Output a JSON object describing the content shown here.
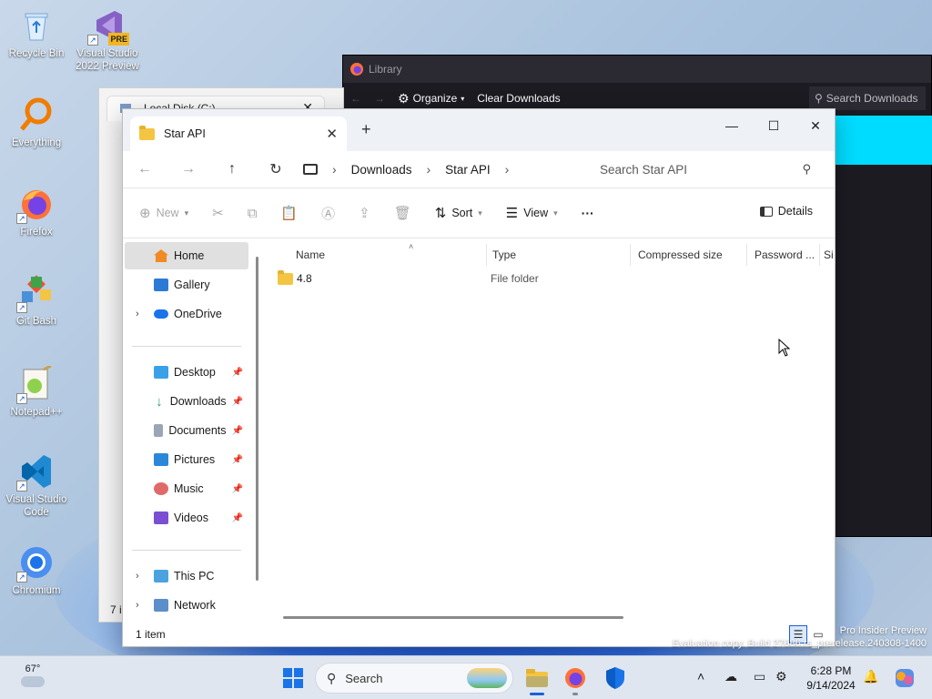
{
  "desktop": {
    "icons": [
      {
        "label": "Recycle Bin",
        "icon": "recycle-bin-icon"
      },
      {
        "label": "Visual Studio 2022 Preview",
        "badge": "PRE",
        "icon": "visual-studio-icon"
      },
      {
        "label": "Everything",
        "icon": "everything-search-icon"
      },
      {
        "label": "Firefox",
        "icon": "firefox-icon"
      },
      {
        "label": "Git Bash",
        "icon": "git-bash-icon"
      },
      {
        "label": "Notepad++",
        "icon": "notepad-plus-plus-icon"
      },
      {
        "label": "Visual Studio Code",
        "icon": "vscode-icon"
      },
      {
        "label": "Chromium",
        "icon": "chromium-icon"
      }
    ],
    "watermark_line1": "Pro Insider Preview",
    "watermark_line2": "Evaluation copy. Build 27686.rs_prerelease.240308-1400"
  },
  "bg_windows": {
    "local_disk_tab": "Local Disk (C:)",
    "local_disk_status": "7 i",
    "library": {
      "title": "Library",
      "organize": "Organize",
      "clear_downloads": "Clear Downloads",
      "search_placeholder": "Search Downloads"
    }
  },
  "explorer": {
    "tab_title": "Star API",
    "breadcrumbs": [
      "Downloads",
      "Star API"
    ],
    "search_placeholder": "Search Star API",
    "commands": {
      "new": "New",
      "sort": "Sort",
      "view": "View",
      "more": "···",
      "details": "Details"
    },
    "nav": [
      {
        "label": "Home"
      },
      {
        "label": "Gallery"
      },
      {
        "label": "OneDrive"
      },
      {
        "label": "Desktop"
      },
      {
        "label": "Downloads"
      },
      {
        "label": "Documents"
      },
      {
        "label": "Pictures"
      },
      {
        "label": "Music"
      },
      {
        "label": "Videos"
      },
      {
        "label": "This PC"
      },
      {
        "label": "Network"
      }
    ],
    "columns": [
      "Name",
      "Type",
      "Compressed size",
      "Password ...",
      "Si"
    ],
    "rows": [
      {
        "name": "4.8",
        "type": "File folder"
      }
    ],
    "status": "1 item"
  },
  "taskbar": {
    "weather_temp": "67°",
    "search_label": "Search",
    "time": "6:28 PM",
    "date": "9/14/2024"
  },
  "colors": {
    "accent": "#1a5fd6",
    "library_bg": "#1c1b22",
    "library_highlight": "#00dcff"
  }
}
